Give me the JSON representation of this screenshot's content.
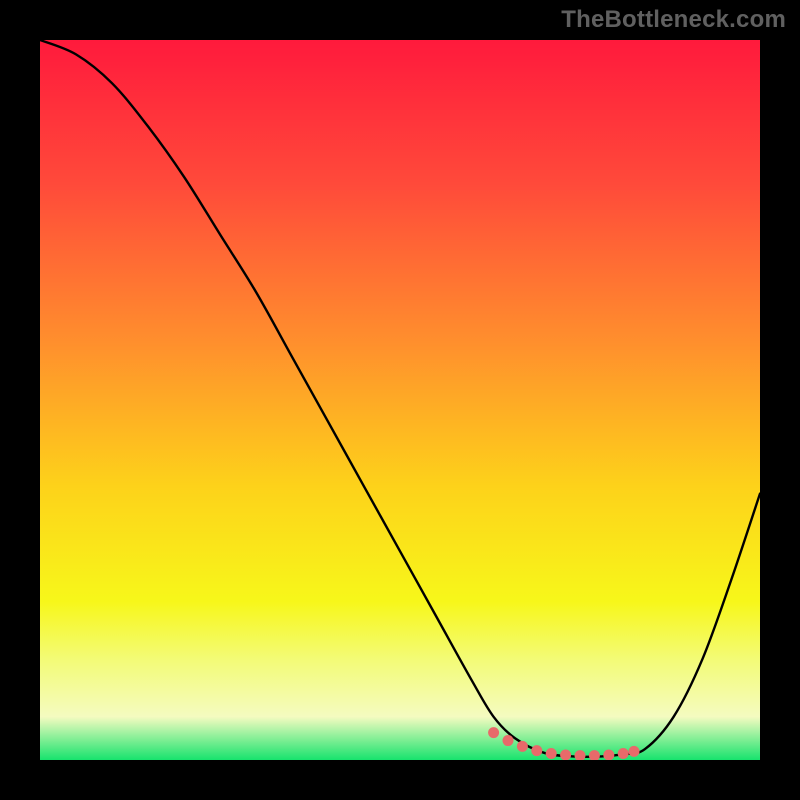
{
  "watermark": "TheBottleneck.com",
  "chart_data": {
    "type": "line",
    "title": "",
    "xlabel": "",
    "ylabel": "",
    "xlim": [
      0,
      100
    ],
    "ylim": [
      0,
      100
    ],
    "grid": false,
    "legend": false,
    "gradient_stops": [
      {
        "offset": 0.0,
        "color": "#ff1a3c"
      },
      {
        "offset": 0.2,
        "color": "#ff4a3a"
      },
      {
        "offset": 0.42,
        "color": "#ff8f2d"
      },
      {
        "offset": 0.62,
        "color": "#fdd21a"
      },
      {
        "offset": 0.78,
        "color": "#f7f71a"
      },
      {
        "offset": 0.86,
        "color": "#f3fb76"
      },
      {
        "offset": 0.94,
        "color": "#f4fbc0"
      },
      {
        "offset": 1.0,
        "color": "#17e36d"
      }
    ],
    "curve": {
      "x": [
        0,
        5,
        10,
        15,
        20,
        25,
        30,
        35,
        40,
        45,
        50,
        55,
        60,
        63,
        66,
        70,
        74,
        78,
        81,
        84,
        88,
        92,
        96,
        100
      ],
      "y": [
        100,
        98,
        94,
        88,
        81,
        73,
        65,
        56,
        47,
        38,
        29,
        20,
        11,
        6,
        3,
        1,
        0.5,
        0.5,
        0.8,
        1.5,
        6,
        14,
        25,
        37
      ]
    },
    "markers": {
      "color": "#e86a6a",
      "x": [
        63,
        65,
        67,
        69,
        71,
        73,
        75,
        77,
        79,
        81,
        82.5
      ],
      "y": [
        3.8,
        2.7,
        1.9,
        1.3,
        0.9,
        0.7,
        0.6,
        0.6,
        0.7,
        0.9,
        1.2
      ]
    }
  }
}
